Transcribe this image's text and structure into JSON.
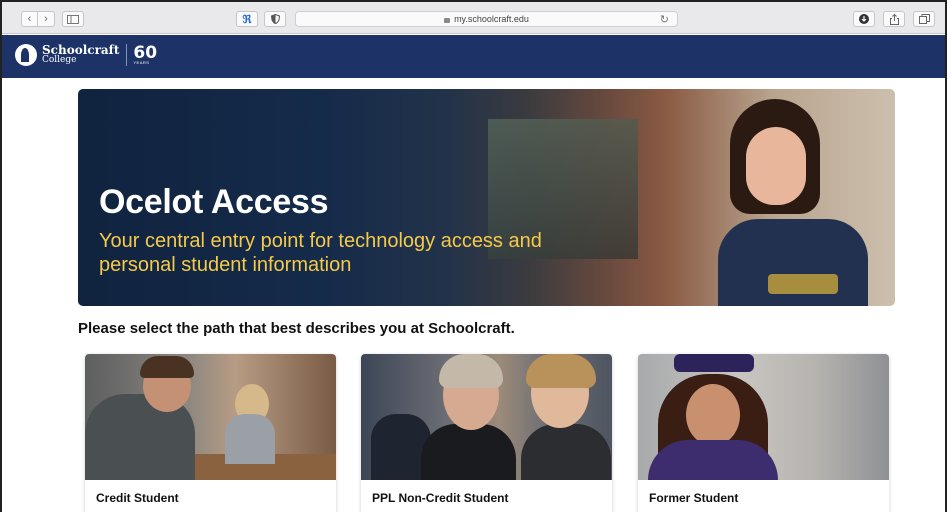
{
  "browser": {
    "url": "my.schoolcraft.edu",
    "back_icon": "chevron-left-icon",
    "forward_icon": "chevron-right-icon",
    "sidebar_icon": "sidebar-icon",
    "extension_icons": [
      "accessibility-icon",
      "shield-icon"
    ],
    "right_icons": [
      "download-icon",
      "share-icon",
      "tabs-icon"
    ]
  },
  "site": {
    "logo_name": "Schoolcraft",
    "logo_sub": "College",
    "logo_anniversary": "60",
    "logo_years": "YEARS",
    "nav_color": "#1d3367"
  },
  "hero": {
    "title": "Ocelot Access",
    "subtitle": "Your central entry point for technology access and personal student information",
    "accent_color": "#f5c94a"
  },
  "prompt": "Please select the path that best describes you at Schoolcraft.",
  "cards": [
    {
      "label": "Credit Student"
    },
    {
      "label": "PPL Non-Credit Student"
    },
    {
      "label": "Former Student"
    }
  ]
}
